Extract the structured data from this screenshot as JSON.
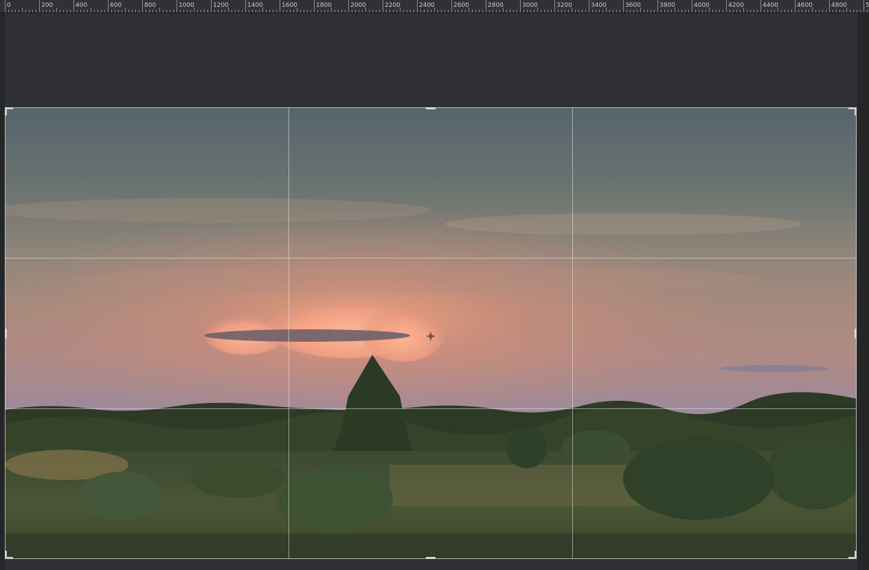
{
  "ruler": {
    "labels": [
      "0",
      "200",
      "400",
      "600",
      "800",
      "1000",
      "1200",
      "1400",
      "1600",
      "1800",
      "2000",
      "2200",
      "2400",
      "2600",
      "2800",
      "3000",
      "3200",
      "3400",
      "3600",
      "3800",
      "4000",
      "4200",
      "4400",
      "4600",
      "4800",
      "5"
    ]
  },
  "icons": {
    "center_marker": "crosshair-icon",
    "handles": "crop-handle-icon"
  },
  "colors": {
    "background": "#2b2d30",
    "ruler_bg": "#2f3134",
    "grid_line": "#ebebeb",
    "sky_top": "#56646c",
    "sky_glow": "#e9a07c"
  }
}
